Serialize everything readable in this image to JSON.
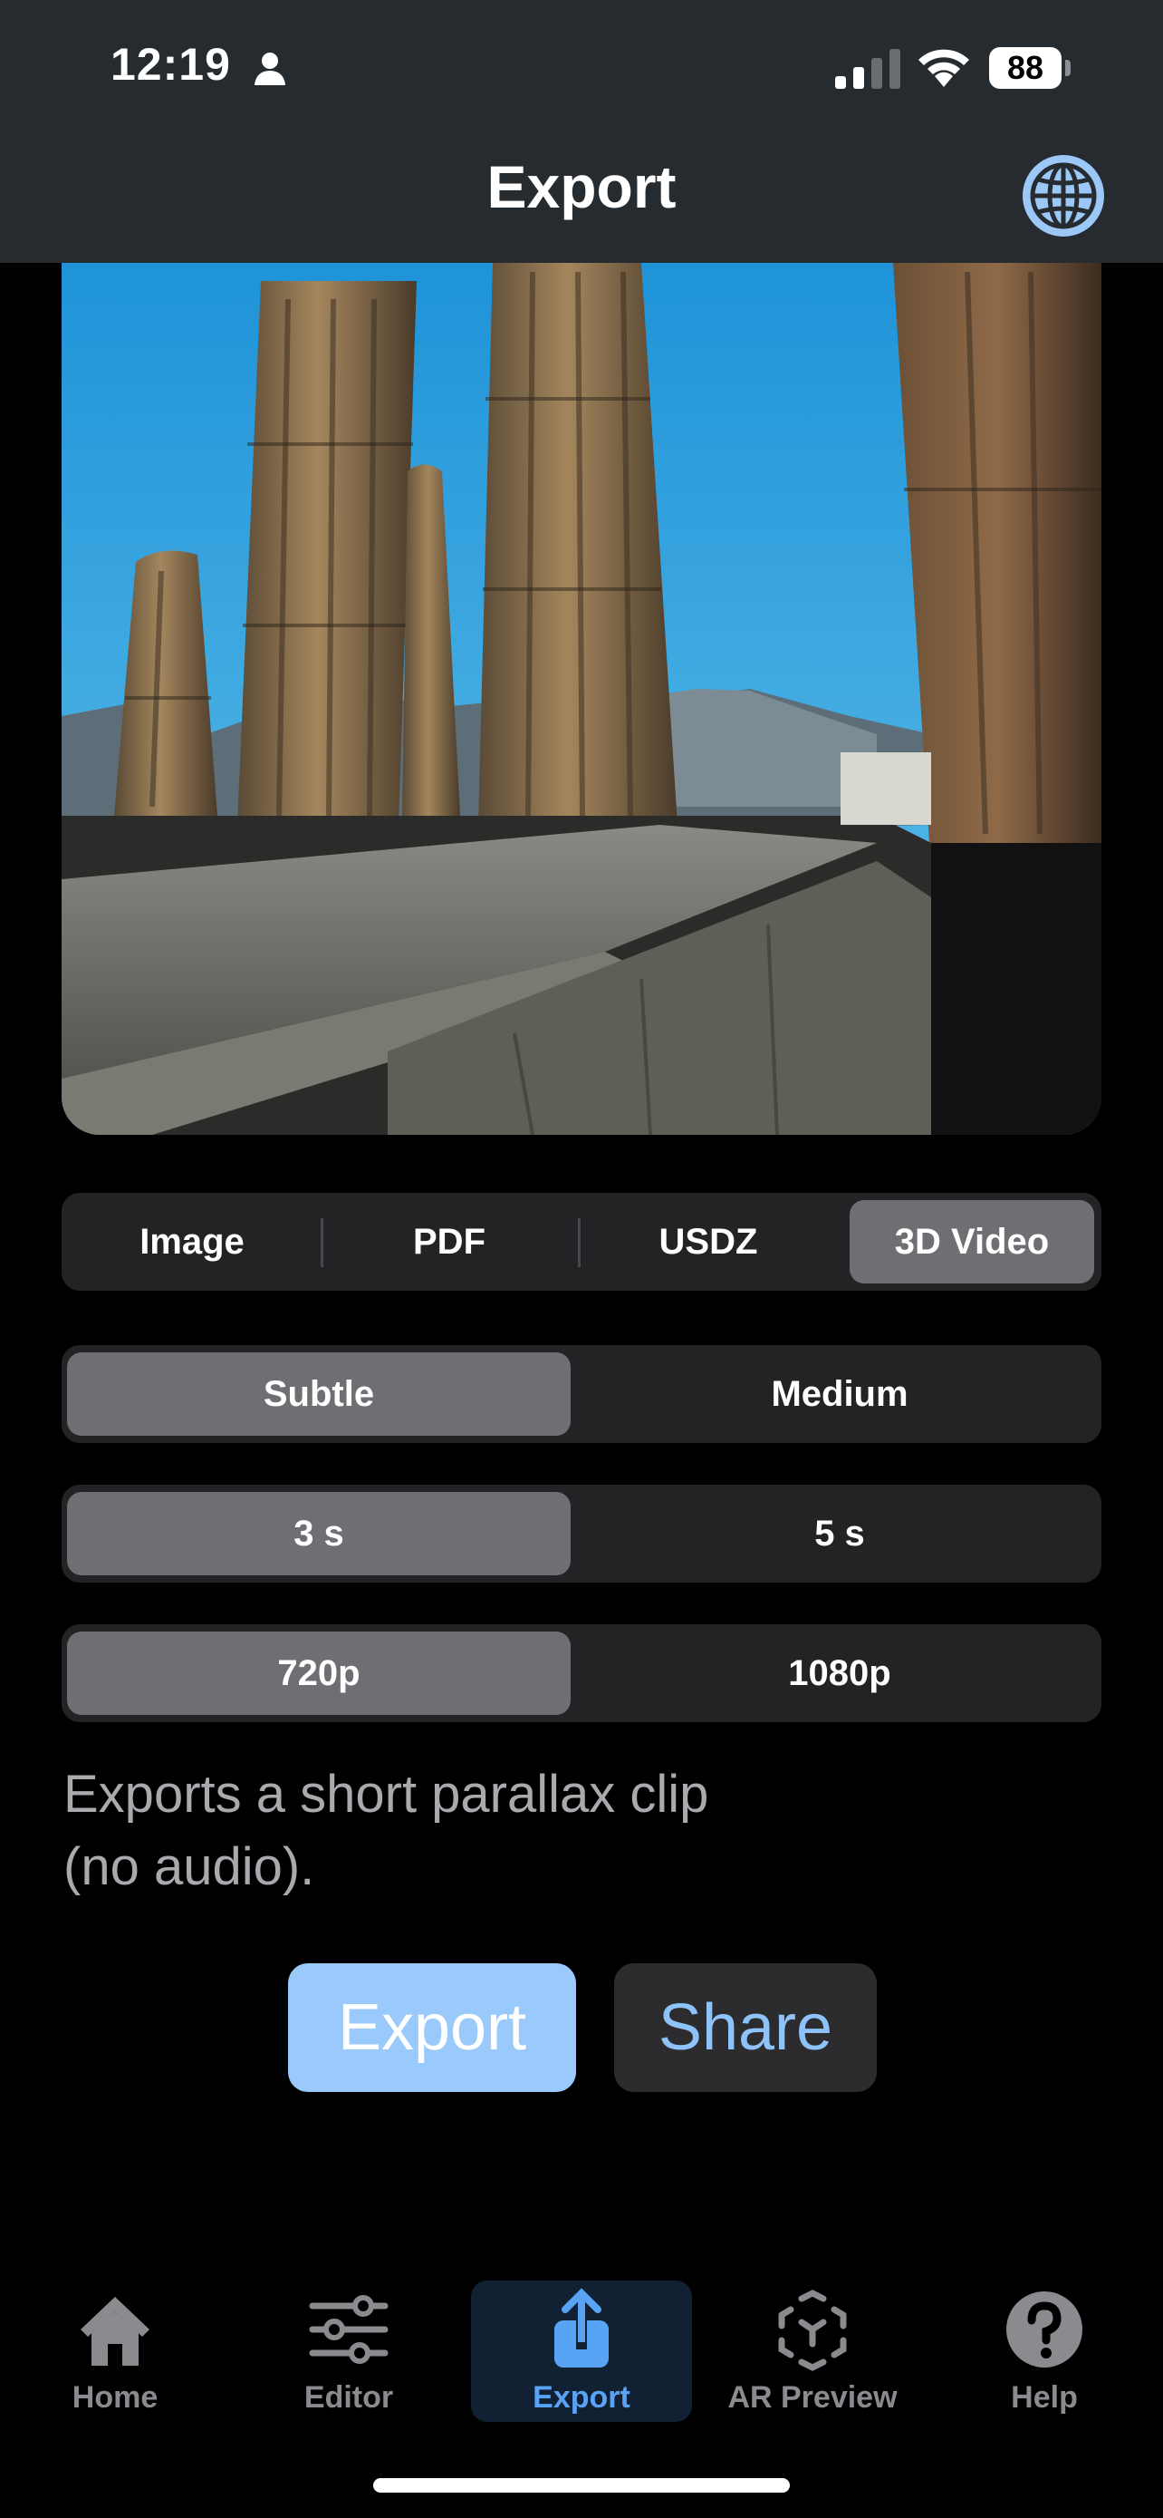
{
  "status_bar": {
    "time": "12:19",
    "battery": "88"
  },
  "header": {
    "title": "Export",
    "globe_icon": "globe-icon"
  },
  "preview": {
    "description": "Ancient stone columns against blue sky"
  },
  "format_tabs": [
    "Image",
    "PDF",
    "USDZ",
    "3D Video"
  ],
  "format_selected": "3D Video",
  "intensity": {
    "options": [
      "Subtle",
      "Medium"
    ],
    "selected": "Subtle"
  },
  "duration": {
    "options": [
      "3 s",
      "5 s"
    ],
    "selected": "3 s"
  },
  "resolution": {
    "options": [
      "720p",
      "1080p"
    ],
    "selected": "720p"
  },
  "info_text_line1": "Exports a short parallax clip",
  "info_text_line2": "(no audio).",
  "actions": {
    "export_label": "Export",
    "share_label": "Share"
  },
  "tabbar": {
    "items": [
      {
        "label": "Home",
        "icon": "house-icon"
      },
      {
        "label": "Editor",
        "icon": "sliders-icon"
      },
      {
        "label": "Export",
        "icon": "share-icon"
      },
      {
        "label": "AR Preview",
        "icon": "ar-cube-icon"
      },
      {
        "label": "Help",
        "icon": "question-icon"
      }
    ],
    "active": "Export"
  },
  "colors": {
    "accent": "#58a3f3",
    "export_button": "#9ac9fb",
    "header_bg": "#262b30"
  }
}
